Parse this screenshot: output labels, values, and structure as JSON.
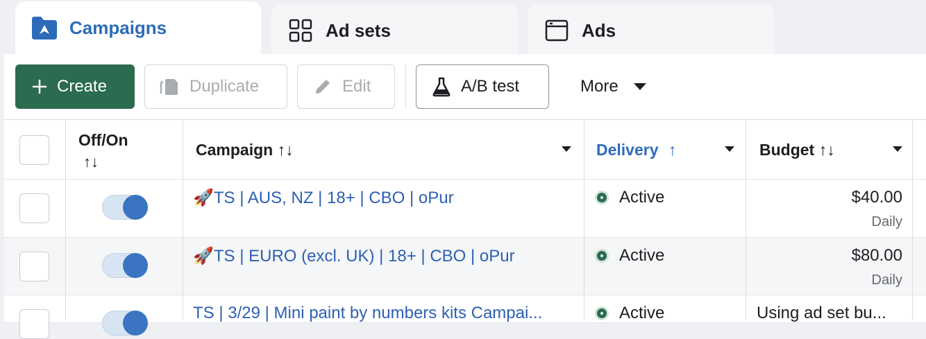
{
  "tabs": [
    {
      "label": "Campaigns",
      "icon": "folder-icon",
      "active": true
    },
    {
      "label": "Ad sets",
      "icon": "grid-icon",
      "active": false
    },
    {
      "label": "Ads",
      "icon": "window-icon",
      "active": false
    }
  ],
  "toolbar": {
    "create_label": "Create",
    "duplicate_label": "Duplicate",
    "edit_label": "Edit",
    "ab_test_label": "A/B test",
    "more_label": "More"
  },
  "table": {
    "headers": {
      "offon": "Off/On",
      "offon_sort": "↑↓",
      "campaign": "Campaign ↑↓",
      "delivery": "Delivery",
      "delivery_sort": "↑",
      "budget": "Budget ↑↓"
    },
    "rows": [
      {
        "campaign": "🚀TS | AUS, NZ | 18+ | CBO | oPur",
        "status": "Active",
        "budget": "$40.00",
        "budget_period": "Daily",
        "on": true
      },
      {
        "campaign": "🚀TS | EURO (excl. UK) | 18+ | CBO | oPur",
        "status": "Active",
        "budget": "$80.00",
        "budget_period": "Daily",
        "on": true
      },
      {
        "campaign": "TS | 3/29 | Mini paint by numbers kits Campai...",
        "status": "Active",
        "budget": "Using ad set bu...",
        "budget_period": "",
        "on": true
      }
    ]
  },
  "colors": {
    "accent": "#2d6bb8",
    "create_green": "#2b6b4f",
    "link": "#2d5fb3",
    "toggle_on": "#3b74c0"
  }
}
